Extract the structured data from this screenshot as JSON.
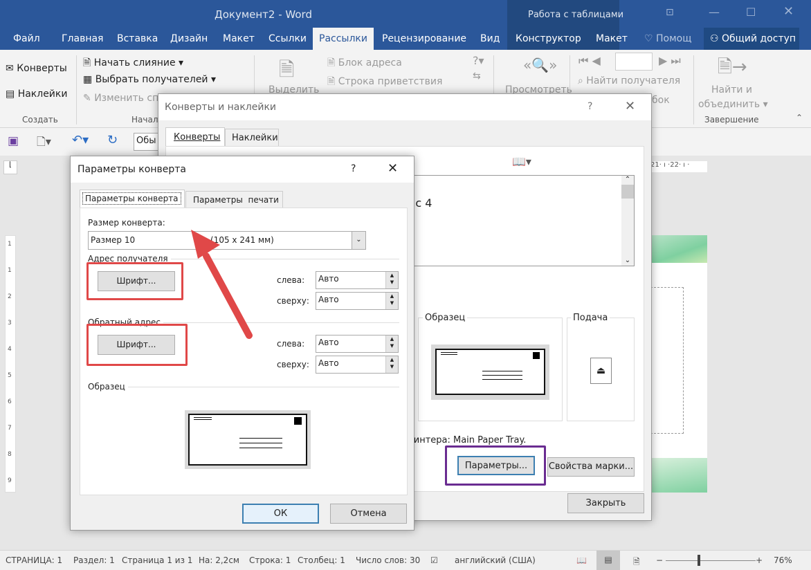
{
  "window": {
    "title": "Документ2 - Word",
    "context_title": "Работа с таблицами"
  },
  "tabs": [
    {
      "label": "Файл"
    },
    {
      "label": "Главная"
    },
    {
      "label": "Вставка"
    },
    {
      "label": "Дизайн"
    },
    {
      "label": "Макет"
    },
    {
      "label": "Ссылки"
    },
    {
      "label": "Рассылки"
    },
    {
      "label": "Рецензирование"
    },
    {
      "label": "Вид"
    },
    {
      "label": "Конструктор"
    },
    {
      "label": "Макет"
    }
  ],
  "help": "Помощ",
  "share": "Общий доступ",
  "ribbon": {
    "create": {
      "envelopes": "Конверты",
      "labels": "Наклейки",
      "group": "Создать"
    },
    "start": {
      "start_merge": "Начать слияние",
      "select_recipients": "Выбрать получателей",
      "edit_list": "Изменить сп",
      "group": "Начал"
    },
    "highlight": "Выделить",
    "address_block": "Блок адреса",
    "greeting": "Строка приветствия",
    "preview": "Просмотреть",
    "find_recipient": "Найти получателя",
    "errors": "бок",
    "finish": {
      "label1": "Найти и",
      "label2": "объединить",
      "group": "Завершение"
    }
  },
  "qat": {
    "style_box": "Обы"
  },
  "envdialog": {
    "title": "Конверты и наклейки",
    "help": "?",
    "tabs": [
      "Конверты",
      "Наклейки"
    ],
    "address_text": "ис 4",
    "sample_label": "Образец",
    "feed_label": "Подача",
    "printer_text": "принтера: Main Paper Tray.",
    "options_btn": "Параметры...",
    "stamp_btn": "Свойства марки...",
    "close_btn": "Закрыть"
  },
  "optdialog": {
    "title": "Параметры конверта",
    "help": "?",
    "tabs": [
      "Параметры конверта",
      "Параметры  печати"
    ],
    "size_label": "Размер конверта:",
    "size_value": "Размер 10",
    "size_dims": "(105 x 241 мм)",
    "recipient": {
      "label": "Адрес получателя",
      "font_btn": "Шрифт...",
      "left_label": "слева:",
      "left_value": "Авто",
      "top_label": "сверху:",
      "top_value": "Авто"
    },
    "return": {
      "label": "Обратный адрес",
      "font_btn": "Шрифт...",
      "left_label": "слева:",
      "left_value": "Авто",
      "top_label": "сверху:",
      "top_value": "Авто"
    },
    "sample_label": "Образец",
    "ok": "ОК",
    "cancel": "Отмена"
  },
  "ruler": {
    "top_text": "21· ı ·22· ı ·",
    "left_marks": [
      "1",
      "1",
      "2",
      "3",
      "4",
      "5",
      "6",
      "7",
      "8",
      "9"
    ]
  },
  "status": {
    "page": "СТРАНИЦА: 1",
    "section": "Раздел: 1",
    "pages": "Страница 1 из 1",
    "at": "На: 2,2см",
    "line": "Строка: 1",
    "column": "Столбец: 1",
    "words": "Число слов: 30",
    "language": "английский (США)",
    "zoom": "76%",
    "zoom_percent": 76
  },
  "colors": {
    "word_blue": "#2b579a",
    "annotation_red": "#e04848",
    "annotation_purple": "#6a2c91",
    "page_green": "#7fd0a0"
  }
}
